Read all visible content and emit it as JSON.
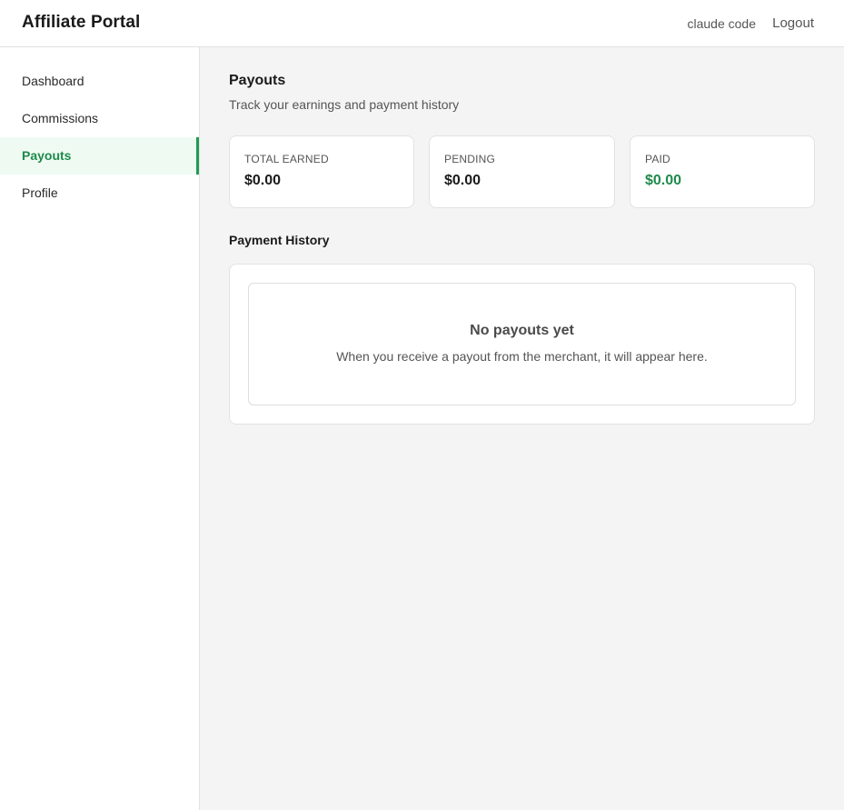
{
  "header": {
    "brand": "Affiliate Portal",
    "user_name": "claude code",
    "logout_label": "Logout"
  },
  "sidebar": {
    "items": [
      {
        "label": "Dashboard",
        "active": false
      },
      {
        "label": "Commissions",
        "active": false
      },
      {
        "label": "Payouts",
        "active": true
      },
      {
        "label": "Profile",
        "active": false
      }
    ]
  },
  "main": {
    "title": "Payouts",
    "subtitle": "Track your earnings and payment history",
    "stats": [
      {
        "label": "TOTAL EARNED",
        "value": "$0.00"
      },
      {
        "label": "PENDING",
        "value": "$0.00"
      },
      {
        "label": "PAID",
        "value": "$0.00"
      }
    ],
    "history_title": "Payment History",
    "empty_title": "No payouts yet",
    "empty_description": "When you receive a payout from the merchant, it will appear here."
  },
  "colors": {
    "accent": "#1e8a4c",
    "active_bg": "#effbf2",
    "page_bg": "#f4f4f4"
  }
}
